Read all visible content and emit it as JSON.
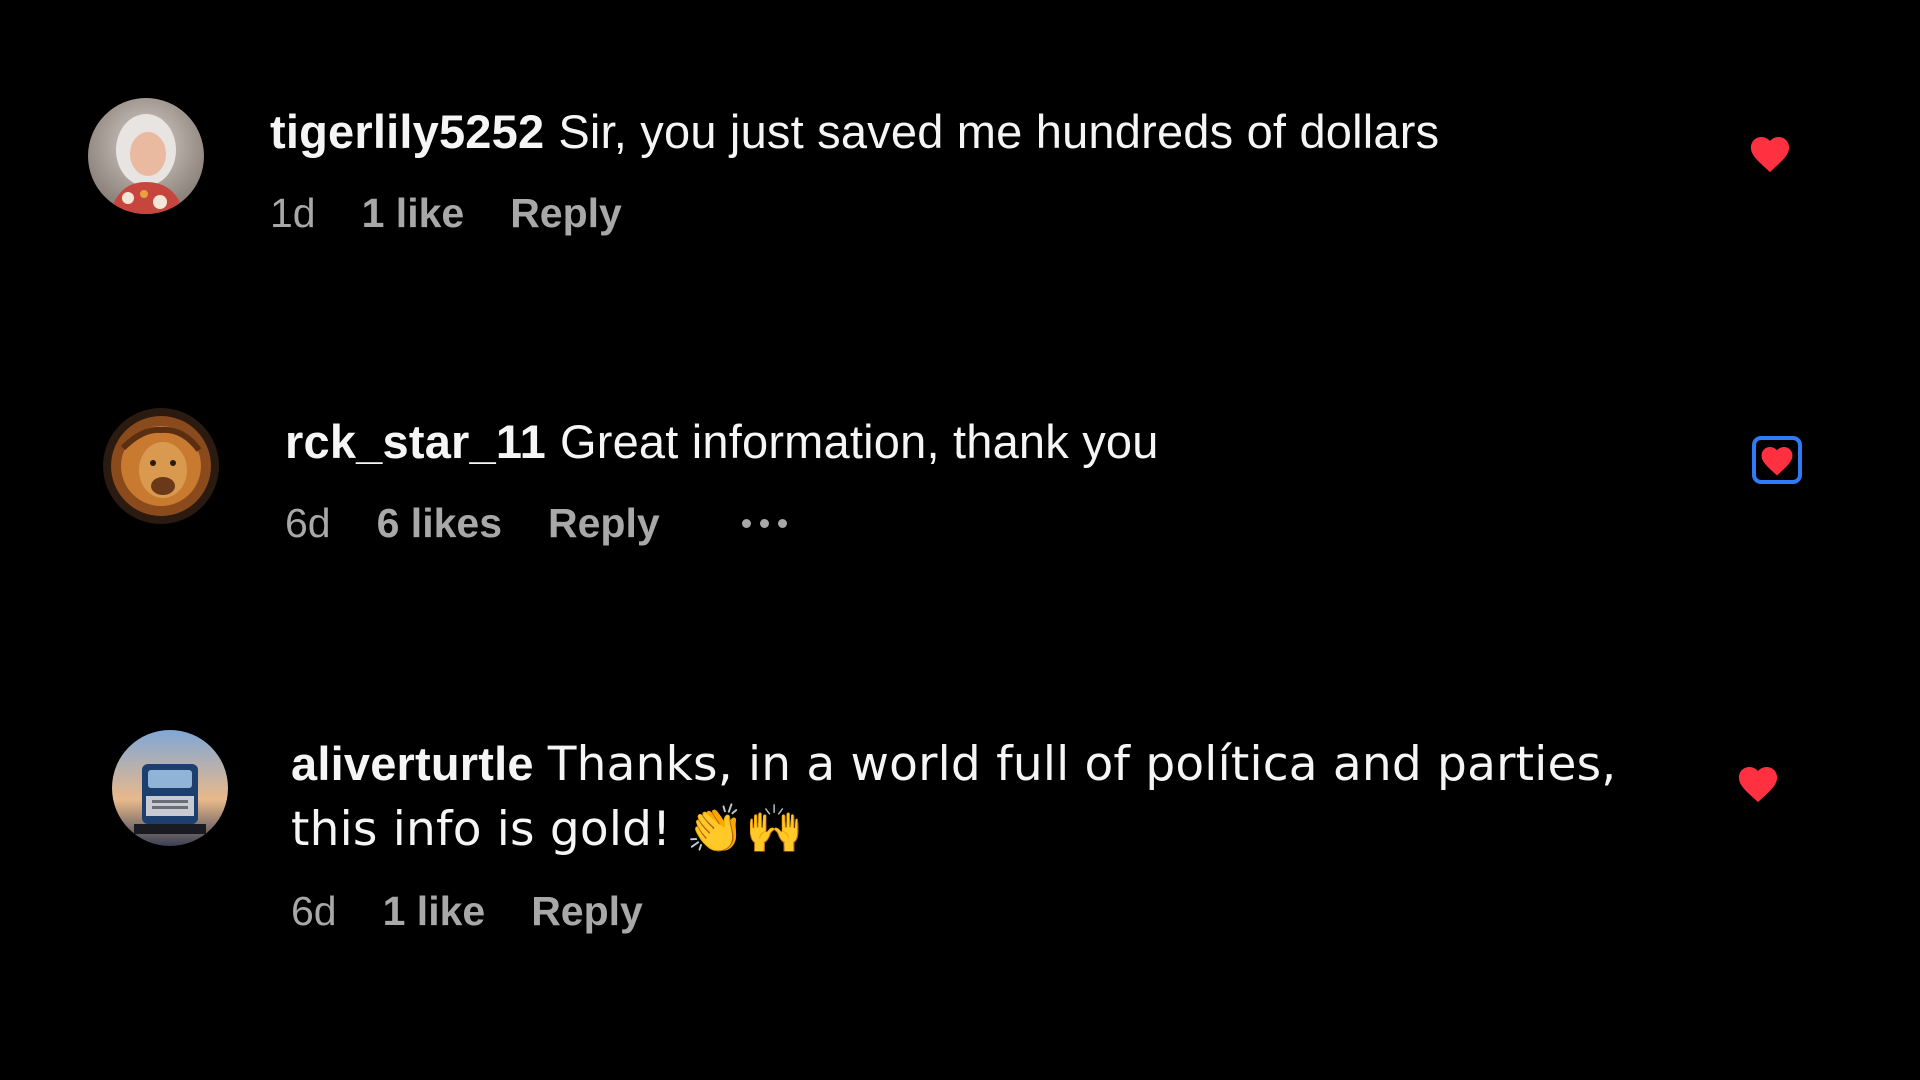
{
  "comments": [
    {
      "username": "tigerlily5252",
      "text": "Sir, you just saved me hundreds of dollars",
      "time": "1d",
      "likes": "1 like",
      "reply_label": "Reply",
      "liked": true
    },
    {
      "username": "rck_star_11",
      "text": "Great information, thank you",
      "time": "6d",
      "likes": "6 likes",
      "reply_label": "Reply",
      "liked": true,
      "show_more_menu": true
    },
    {
      "username": "aliverturtle",
      "text": "Thanks, in a world full of política and parties, this info is gold! 👏🙌",
      "time": "6d",
      "likes": "1 like",
      "reply_label": "Reply",
      "liked": true
    }
  ],
  "icons": {
    "heart": "heart-icon",
    "more": "more-options-icon"
  },
  "colors": {
    "background": "#000000",
    "heart": "#ff3040",
    "focus_ring": "#2f7bf5",
    "meta_text": "#a8a8a8"
  }
}
